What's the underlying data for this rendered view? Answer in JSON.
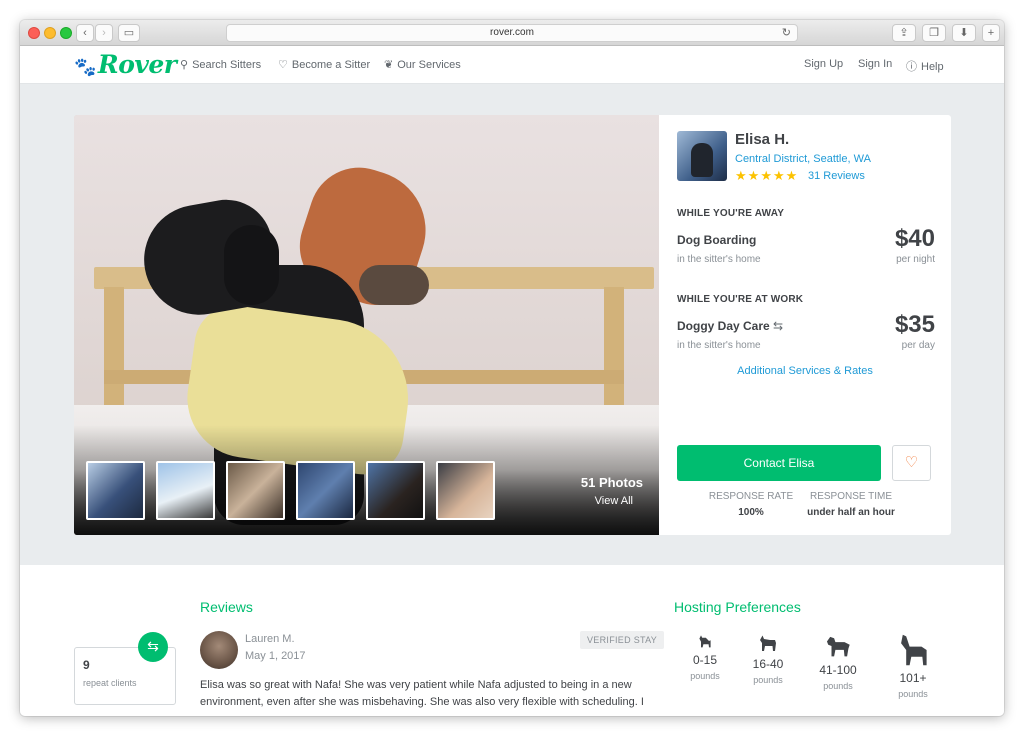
{
  "browser": {
    "url": "rover.com"
  },
  "nav": {
    "logo": "Rover",
    "search_sitters": "Search Sitters",
    "become_sitter": "Become a Sitter",
    "our_services": "Our Services",
    "sign_up": "Sign Up",
    "sign_in": "Sign In",
    "help": "Help"
  },
  "gallery": {
    "photo_count": "51 Photos",
    "view_all": "View All",
    "thumb_count": 6
  },
  "profile": {
    "name": "Elisa H.",
    "neighborhood": "Central District",
    "city": "Seattle, WA",
    "rating_stars": 5,
    "reviews_link": "31 Reviews",
    "section_away": "WHILE YOU'RE AWAY",
    "section_work": "WHILE YOU'RE AT WORK",
    "services": [
      {
        "name": "Dog Boarding",
        "sub": "in the sitter's home",
        "price": "$40",
        "unit": "per night"
      },
      {
        "name": "Doggy Day Care",
        "sub": "in the sitter's home",
        "price": "$35",
        "unit": "per day"
      }
    ],
    "additional_link": "Additional Services & Rates",
    "contact_button": "Contact Elisa",
    "response_rate_label": "RESPONSE RATE",
    "response_rate_value": "100%",
    "response_time_label": "RESPONSE TIME",
    "response_time_value": "under half an hour"
  },
  "reviews": {
    "heading": "Reviews",
    "repeat_count": "9",
    "repeat_label": "repeat clients",
    "reviewer": "Lauren M.",
    "date": "May 1, 2017",
    "badge": "VERIFIED STAY",
    "text": "Elisa was so great with Nafa! She was very patient while Nafa adjusted to being in a new environment, even after she was misbehaving. She was also very flexible with scheduling. I"
  },
  "hosting": {
    "heading": "Hosting Preferences",
    "sizes": [
      {
        "range": "0-15",
        "unit": "pounds"
      },
      {
        "range": "16-40",
        "unit": "pounds"
      },
      {
        "range": "41-100",
        "unit": "pounds"
      },
      {
        "range": "101+",
        "unit": "pounds"
      }
    ]
  },
  "colors": {
    "brand_green": "#00bd70",
    "link_blue": "#1f9ad6",
    "star_yellow": "#fcc200",
    "heart_orange": "#f27c3c"
  },
  "icons": [
    "search-icon",
    "heart-icon",
    "paw-icon",
    "help-icon",
    "repeat-icon",
    "star-icon",
    "dog-icon"
  ]
}
